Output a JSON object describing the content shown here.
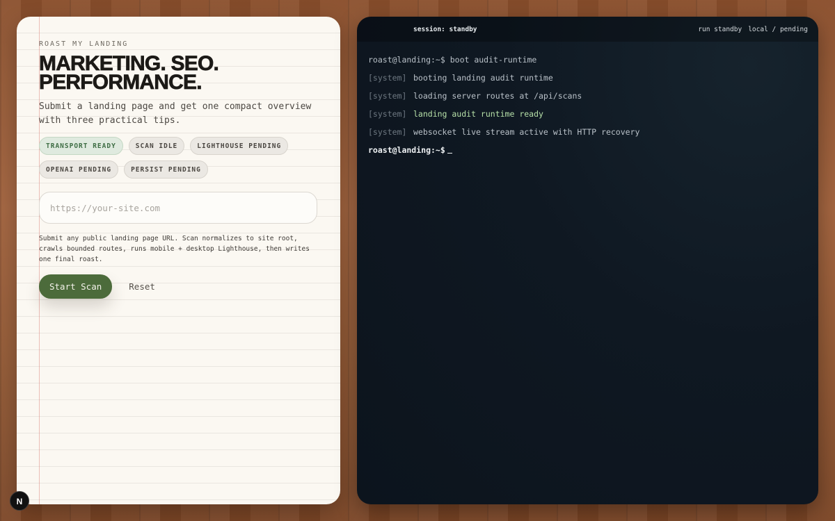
{
  "left_panel": {
    "kicker": "ROAST MY LANDING",
    "headline_line1": "MARKETING. SEO.",
    "headline_line2": "PERFORMANCE.",
    "subtitle": "Submit a landing page and get one compact overview with three practical tips.",
    "chips": [
      {
        "label": "TRANSPORT READY",
        "state": "ready"
      },
      {
        "label": "SCAN IDLE",
        "state": "idle"
      },
      {
        "label": "LIGHTHOUSE PENDING",
        "state": "pending"
      },
      {
        "label": "OPENAI PENDING",
        "state": "pending"
      },
      {
        "label": "PERSIST PENDING",
        "state": "pending"
      }
    ],
    "url_input": {
      "placeholder": "https://your-site.com",
      "value": ""
    },
    "helper_text": "Submit any public landing page URL. Scan normalizes to site root, crawls bounded routes, runs mobile + desktop Lighthouse, then writes one final roast.",
    "start_button": "Start Scan",
    "reset_button": "Reset"
  },
  "terminal": {
    "session_label": "session: standby",
    "status": {
      "run": "run standby",
      "mode": "local / pending"
    },
    "boot_prompt": "roast@landing:~$",
    "boot_command": "boot audit-runtime",
    "lines": [
      {
        "tag": "[system]",
        "text": "booting landing audit runtime",
        "ok": false
      },
      {
        "tag": "[system]",
        "text": "loading server routes at /api/scans",
        "ok": false
      },
      {
        "tag": "[system]",
        "text": "landing audit runtime ready",
        "ok": true
      },
      {
        "tag": "[system]",
        "text": "websocket live stream active with HTTP recovery",
        "ok": false
      }
    ],
    "final_prompt": "roast@landing:~$"
  },
  "badge": {
    "letter": "N"
  },
  "colors": {
    "accent_green": "#4c6b3b",
    "ready_green": "#3f6e45",
    "terminal_bg": "#0f1822",
    "ok_text": "#b6e0a8"
  },
  "icons": [
    "nextjs-badge-icon"
  ]
}
